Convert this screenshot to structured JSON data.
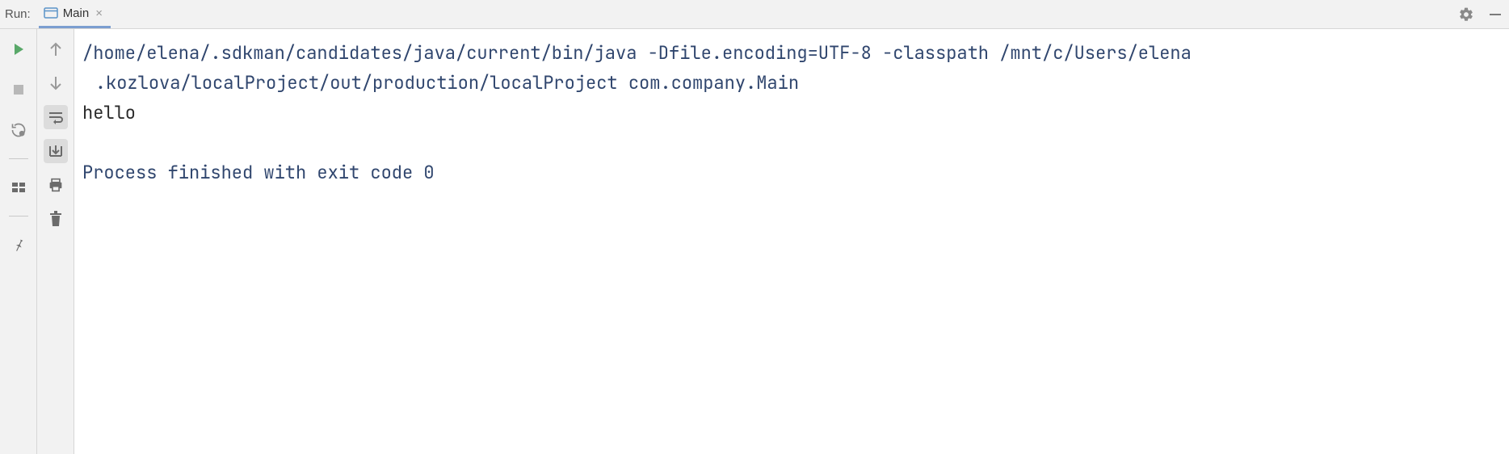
{
  "header": {
    "run_label": "Run:",
    "tab": {
      "label": "Main"
    }
  },
  "console": {
    "cmd_line1": "/home/elena/.sdkman/candidates/java/current/bin/java -Dfile.encoding=UTF-8 -classpath /mnt/c/Users/elena",
    "cmd_line2": ".kozlova/localProject/out/production/localProject com.company.Main",
    "output": "hello",
    "exit_line": "Process finished with exit code 0"
  }
}
